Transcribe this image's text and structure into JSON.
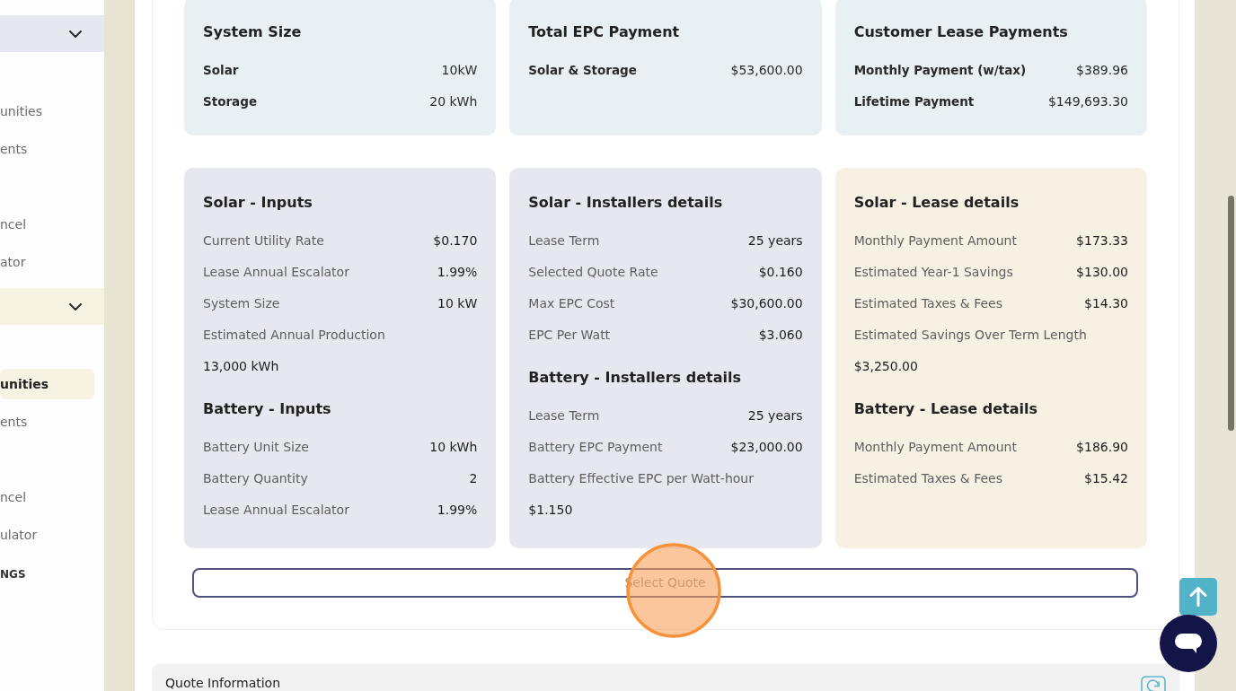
{
  "sidebar": {
    "groups": [
      {
        "expanded": true,
        "color": "#e7e7f0",
        "items": [
          {
            "label": "unities",
            "selected": false
          },
          {
            "label": "ents",
            "selected": false
          },
          {
            "label": "ncel",
            "selected": false
          },
          {
            "label": "ator",
            "selected": false
          }
        ]
      },
      {
        "expanded": true,
        "color": "#f7f3e3",
        "items": [
          {
            "label": "unities",
            "selected": true
          },
          {
            "label": "ents",
            "selected": false
          },
          {
            "label": "ncel",
            "selected": false
          },
          {
            "label": "ulator",
            "selected": false
          }
        ]
      }
    ],
    "section_label": "NGS"
  },
  "summary_cards": [
    {
      "title": "System Size",
      "rows": [
        {
          "label": "Solar",
          "value": "10kW"
        },
        {
          "label": "Storage",
          "value": "20 kWh"
        }
      ]
    },
    {
      "title": "Total EPC Payment",
      "rows": [
        {
          "label": "Solar & Storage",
          "value": "$53,600.00"
        }
      ]
    },
    {
      "title": "Customer Lease Payments",
      "rows": [
        {
          "label": "Monthly Payment (w/tax)",
          "value": "$389.96"
        },
        {
          "label": "Lifetime Payment",
          "value": "$149,693.30"
        }
      ]
    }
  ],
  "detail_cards": [
    {
      "color": "#e7e7f0",
      "sections": [
        {
          "title": "Solar - Inputs",
          "rows": [
            {
              "kind": "pair",
              "label": "Current Utility Rate",
              "value": "$0.170"
            },
            {
              "kind": "pair",
              "label": "Lease Annual Escalator",
              "value": "1.99%"
            },
            {
              "kind": "pair",
              "label": "System Size",
              "value": "10 kW"
            },
            {
              "kind": "stacked",
              "label": "Estimated Annual Production",
              "value": "13,000 kWh"
            }
          ]
        },
        {
          "title": "Battery - Inputs",
          "rows": [
            {
              "kind": "pair",
              "label": "Battery Unit Size",
              "value": "10 kWh"
            },
            {
              "kind": "pair",
              "label": "Battery Quantity",
              "value": "2"
            },
            {
              "kind": "pair",
              "label": "Lease Annual Escalator",
              "value": "1.99%"
            }
          ]
        }
      ]
    },
    {
      "color": "#e7e7f0",
      "sections": [
        {
          "title": "Solar - Installers details",
          "rows": [
            {
              "kind": "pair",
              "label": "Lease Term",
              "value": "25 years"
            },
            {
              "kind": "pair",
              "label": "Selected Quote Rate",
              "value": "$0.160"
            },
            {
              "kind": "pair",
              "label": "Max EPC Cost",
              "value": "$30,600.00"
            },
            {
              "kind": "pair",
              "label": "EPC Per Watt",
              "value": "$3.060"
            }
          ]
        },
        {
          "title": "Battery - Installers details",
          "rows": [
            {
              "kind": "pair",
              "label": "Lease Term",
              "value": "25 years"
            },
            {
              "kind": "pair",
              "label": "Battery EPC Payment",
              "value": "$23,000.00"
            },
            {
              "kind": "stacked",
              "label": "Battery Effective EPC per Watt-hour",
              "value": "$1.150"
            }
          ]
        }
      ]
    },
    {
      "color": "#f7f1e3",
      "sections": [
        {
          "title": "Solar - Lease details",
          "rows": [
            {
              "kind": "pair",
              "label": "Monthly Payment Amount",
              "value": "$173.33"
            },
            {
              "kind": "pair",
              "label": "Estimated Year-1 Savings",
              "value": "$130.00"
            },
            {
              "kind": "pair",
              "label": "Estimated Taxes & Fees",
              "value": "$14.30"
            },
            {
              "kind": "stacked",
              "label": "Estimated Savings Over Term Length",
              "value": "$3,250.00"
            }
          ]
        },
        {
          "title": "Battery - Lease details",
          "rows": [
            {
              "kind": "pair",
              "label": "Monthly Payment Amount",
              "value": "$186.90"
            },
            {
              "kind": "pair",
              "label": "Estimated Taxes & Fees",
              "value": "$15.42"
            }
          ]
        }
      ]
    }
  ],
  "select_button": {
    "label": "Select Quote"
  },
  "quote_information": {
    "title": "Quote Information"
  }
}
